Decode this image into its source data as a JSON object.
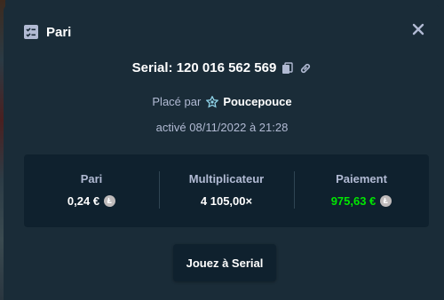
{
  "modal": {
    "title": "Pari",
    "title_icon": "bet-slip-icon",
    "close_icon": "close-icon"
  },
  "serial": {
    "label": "Serial: 120 016 562 569",
    "copy_icon": "copy-icon",
    "link_icon": "link-icon"
  },
  "placed": {
    "prefix": "Placé par",
    "user": "Poucepouce",
    "user_icon": "star-badge-icon"
  },
  "date": "activé 08/11/2022 à 21:28",
  "stats": [
    {
      "label": "Pari",
      "value": "0,24 €",
      "coin_icon": "litecoin-icon"
    },
    {
      "label": "Multiplicateur",
      "value": "4 105,00×"
    },
    {
      "label": "Paiement",
      "value": "975,63 €",
      "coin_icon": "litecoin-icon"
    }
  ],
  "play_button": "Jouez à Serial",
  "colors": {
    "background": "#1a2c38",
    "panel": "#0f212e",
    "muted_text": "#b1bad3",
    "payout_green": "#00e701"
  }
}
